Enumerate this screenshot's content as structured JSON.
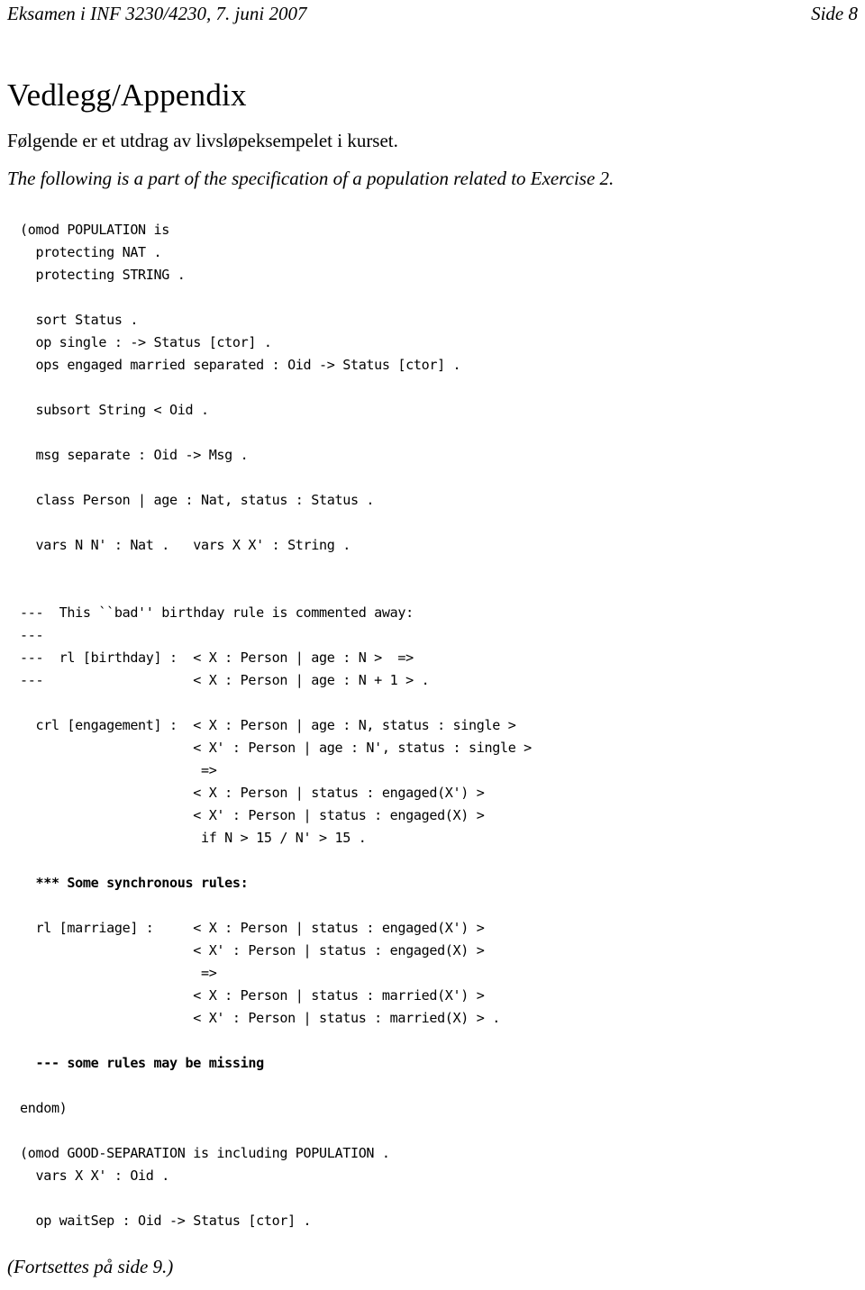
{
  "header": {
    "left": "Eksamen i INF 3230/4230, 7. juni 2007",
    "right": "Side 8"
  },
  "title": "Vedlegg/Appendix",
  "intro": {
    "norwegian": "Følgende er et utdrag av livsløpeksempelet i kurset.",
    "english": "The following is a part of the specification of a population related to Exercise 2."
  },
  "code": {
    "lines": [
      {
        "text": "(omod POPULATION is",
        "bold": false
      },
      {
        "text": "  protecting NAT .",
        "bold": false
      },
      {
        "text": "  protecting STRING .",
        "bold": false
      },
      {
        "text": "",
        "bold": false
      },
      {
        "text": "  sort Status .",
        "bold": false
      },
      {
        "text": "  op single : -> Status [ctor] .",
        "bold": false
      },
      {
        "text": "  ops engaged married separated : Oid -> Status [ctor] .",
        "bold": false
      },
      {
        "text": "",
        "bold": false
      },
      {
        "text": "  subsort String < Oid .",
        "bold": false
      },
      {
        "text": "",
        "bold": false
      },
      {
        "text": "  msg separate : Oid -> Msg .",
        "bold": false
      },
      {
        "text": "",
        "bold": false
      },
      {
        "text": "  class Person | age : Nat, status : Status .",
        "bold": false
      },
      {
        "text": "",
        "bold": false
      },
      {
        "text": "  vars N N' : Nat .   vars X X' : String .",
        "bold": false
      },
      {
        "text": "",
        "bold": false
      },
      {
        "text": "",
        "bold": false
      },
      {
        "text": "---  This ``bad'' birthday rule is commented away:",
        "bold": false
      },
      {
        "text": "---",
        "bold": false
      },
      {
        "text": "---  rl [birthday] :  < X : Person | age : N >  =>",
        "bold": false
      },
      {
        "text": "---                   < X : Person | age : N + 1 > .",
        "bold": false
      },
      {
        "text": "",
        "bold": false
      },
      {
        "text": "  crl [engagement] :  < X : Person | age : N, status : single >",
        "bold": false
      },
      {
        "text": "                      < X' : Person | age : N', status : single >",
        "bold": false
      },
      {
        "text": "                       =>",
        "bold": false
      },
      {
        "text": "                      < X : Person | status : engaged(X') >",
        "bold": false
      },
      {
        "text": "                      < X' : Person | status : engaged(X) >",
        "bold": false
      },
      {
        "text": "                       if N > 15 / N' > 15 .",
        "bold": false
      },
      {
        "text": "",
        "bold": false
      },
      {
        "text": "  *** Some synchronous rules:",
        "bold": true
      },
      {
        "text": "",
        "bold": false
      },
      {
        "text": "  rl [marriage] :     < X : Person | status : engaged(X') >",
        "bold": false
      },
      {
        "text": "                      < X' : Person | status : engaged(X) >",
        "bold": false
      },
      {
        "text": "                       =>",
        "bold": false
      },
      {
        "text": "                      < X : Person | status : married(X') >",
        "bold": false
      },
      {
        "text": "                      < X' : Person | status : married(X) > .",
        "bold": false
      },
      {
        "text": "",
        "bold": false
      },
      {
        "text": "  --- some rules may be missing",
        "bold": true
      },
      {
        "text": "",
        "bold": false
      },
      {
        "text": "endom)",
        "bold": false
      },
      {
        "text": "",
        "bold": false
      },
      {
        "text": "(omod GOOD-SEPARATION is including POPULATION .",
        "bold": false
      },
      {
        "text": "  vars X X' : Oid .",
        "bold": false
      },
      {
        "text": "",
        "bold": false
      },
      {
        "text": "  op waitSep : Oid -> Status [ctor] .",
        "bold": false
      }
    ]
  },
  "footer": "(Fortsettes på side 9.)"
}
